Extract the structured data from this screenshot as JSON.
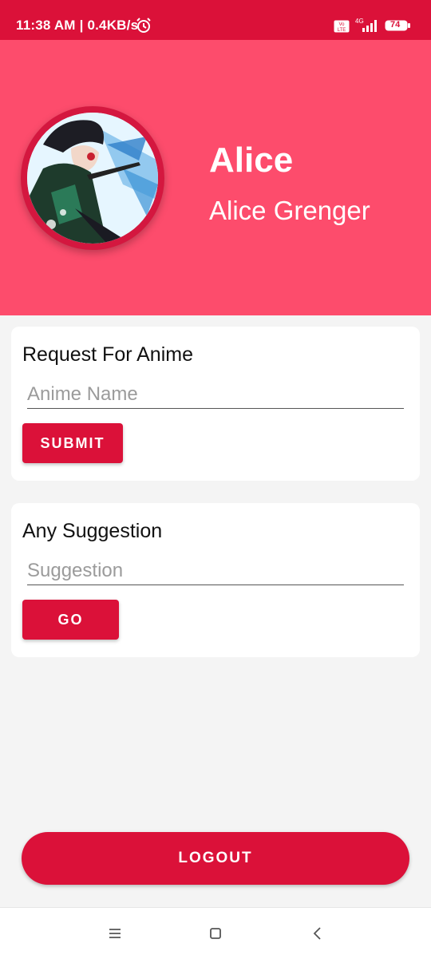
{
  "status_bar": {
    "text": "11:38 AM | 0.4KB/s",
    "network": "4G",
    "battery": "74",
    "icons": [
      "alarm-icon",
      "volte-icon",
      "signal-icon",
      "battery-icon"
    ]
  },
  "profile": {
    "username": "Alice",
    "full_name": "Alice Grenger"
  },
  "request_card": {
    "title": "Request For Anime",
    "placeholder": "Anime Name",
    "button": "SUBMIT"
  },
  "suggestion_card": {
    "title": "Any Suggestion",
    "placeholder": "Suggestion",
    "button": "GO"
  },
  "logout_label": "LOGOUT",
  "nav": {
    "icons": [
      "menu-icon",
      "home-icon",
      "back-icon"
    ]
  },
  "colors": {
    "primary": "#db1139",
    "header": "#fd4c6c",
    "background": "#f4f4f4"
  }
}
